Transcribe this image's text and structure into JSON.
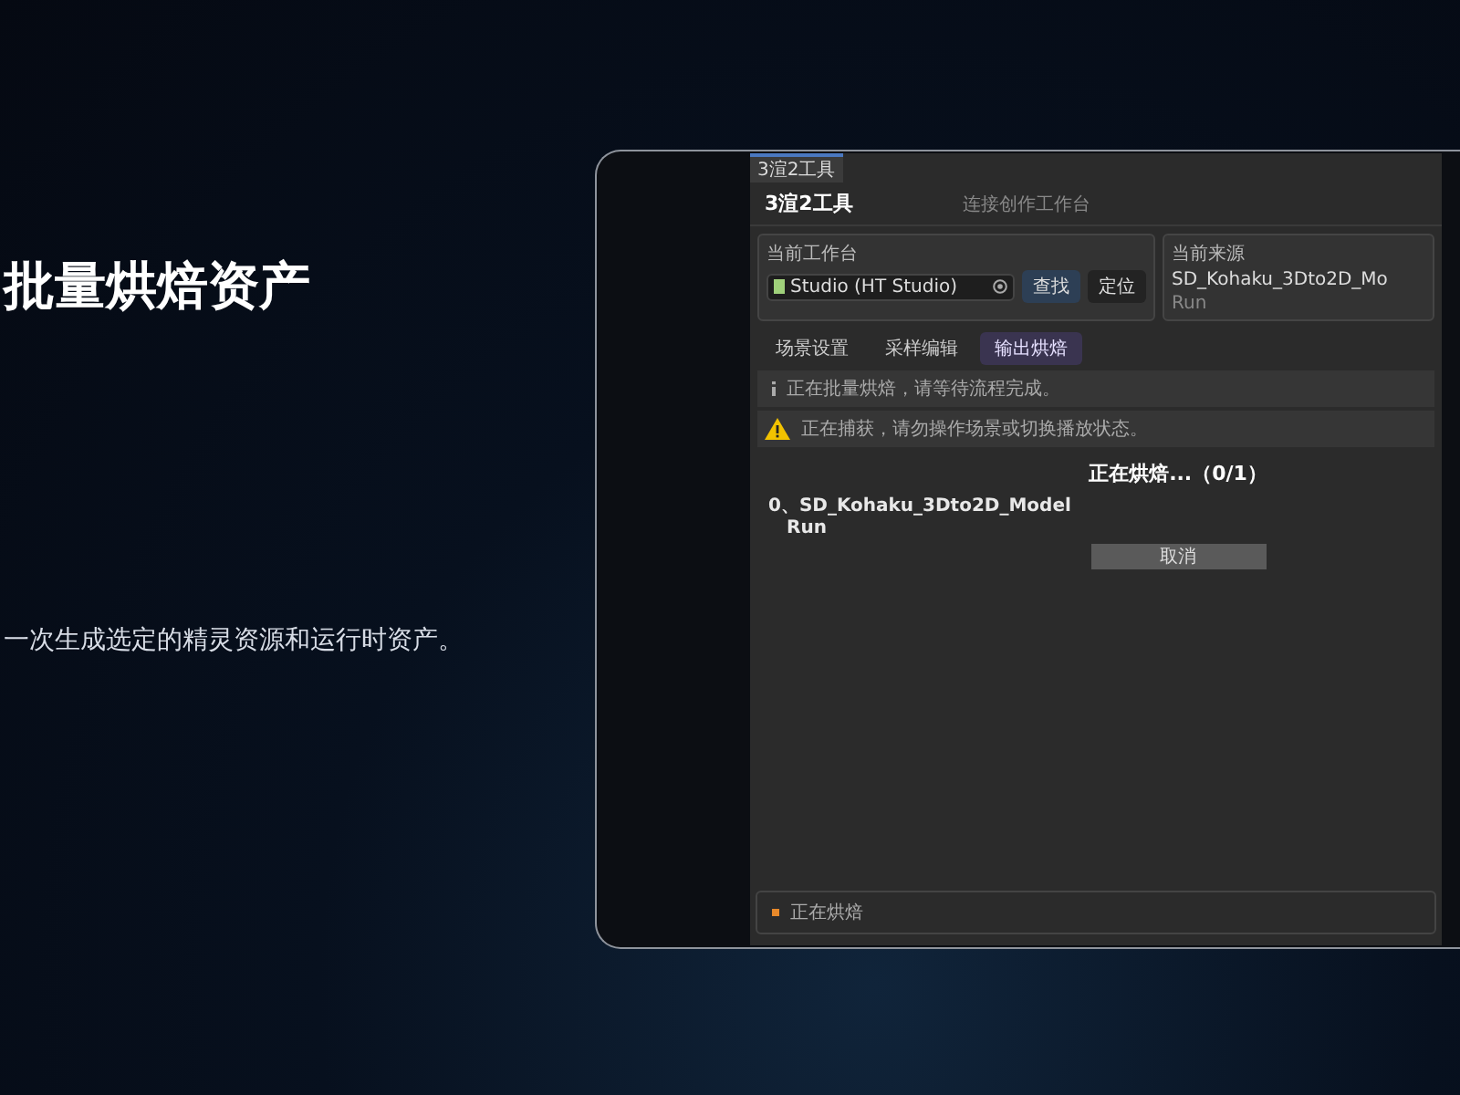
{
  "slide": {
    "title": "批量烘焙资产",
    "description": "一次生成选定的精灵资源和运行时资产。"
  },
  "app": {
    "window_tab": "3渲2工具",
    "title": "3渲2工具",
    "subtitle": "连接创作工作台",
    "workbench": {
      "label": "当前工作台",
      "value": "Studio (HT Studio)",
      "buttons": [
        {
          "label": "查找",
          "kind": "primary"
        },
        {
          "label": "定位",
          "kind": "secondary"
        }
      ]
    },
    "source": {
      "label": "当前来源",
      "name": "SD_Kohaku_3Dto2D_Mo",
      "detail": "Run"
    },
    "tabs": [
      {
        "label": "场景设置",
        "selected": false
      },
      {
        "label": "采样编辑",
        "selected": false
      },
      {
        "label": "输出烘焙",
        "selected": true
      }
    ],
    "notices": [
      {
        "kind": "info",
        "text": "正在批量烘焙，请等待流程完成。"
      },
      {
        "kind": "warning",
        "text": "正在捕获，请勿操作场景或切换播放状态。"
      }
    ],
    "progress": {
      "heading": "正在烘焙...（0/1）",
      "items": [
        {
          "name": "0、SD_Kohaku_3Dto2D_Model",
          "detail": "Run"
        }
      ],
      "cancel": "取消"
    },
    "status": {
      "text": "正在烘焙",
      "color": "#e8892a"
    }
  }
}
